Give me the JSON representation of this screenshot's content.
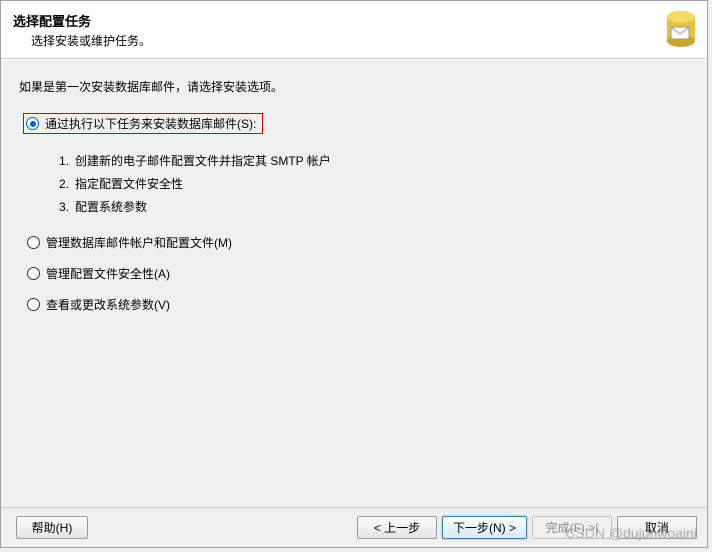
{
  "header": {
    "title": "选择配置任务",
    "subtitle": "选择安装或维护任务。"
  },
  "intro": "如果是第一次安装数据库邮件，请选择安装选项。",
  "options": {
    "install": {
      "label": "通过执行以下任务来安装数据库邮件(S):",
      "steps": [
        {
          "num": "1.",
          "text": "创建新的电子邮件配置文件并指定其 SMTP 帐户"
        },
        {
          "num": "2.",
          "text": "指定配置文件安全性"
        },
        {
          "num": "3.",
          "text": "配置系统参数"
        }
      ]
    },
    "manage_accounts": "管理数据库邮件帐户和配置文件(M)",
    "manage_security": "管理配置文件安全性(A)",
    "view_params": "查看或更改系统参数(V)"
  },
  "footer": {
    "help": "帮助(H)",
    "back": "< 上一步",
    "next": "下一步(N) >",
    "finish": "完成(F) >|",
    "cancel": "取消"
  },
  "watermark": "CSDN @dujunwoaini"
}
